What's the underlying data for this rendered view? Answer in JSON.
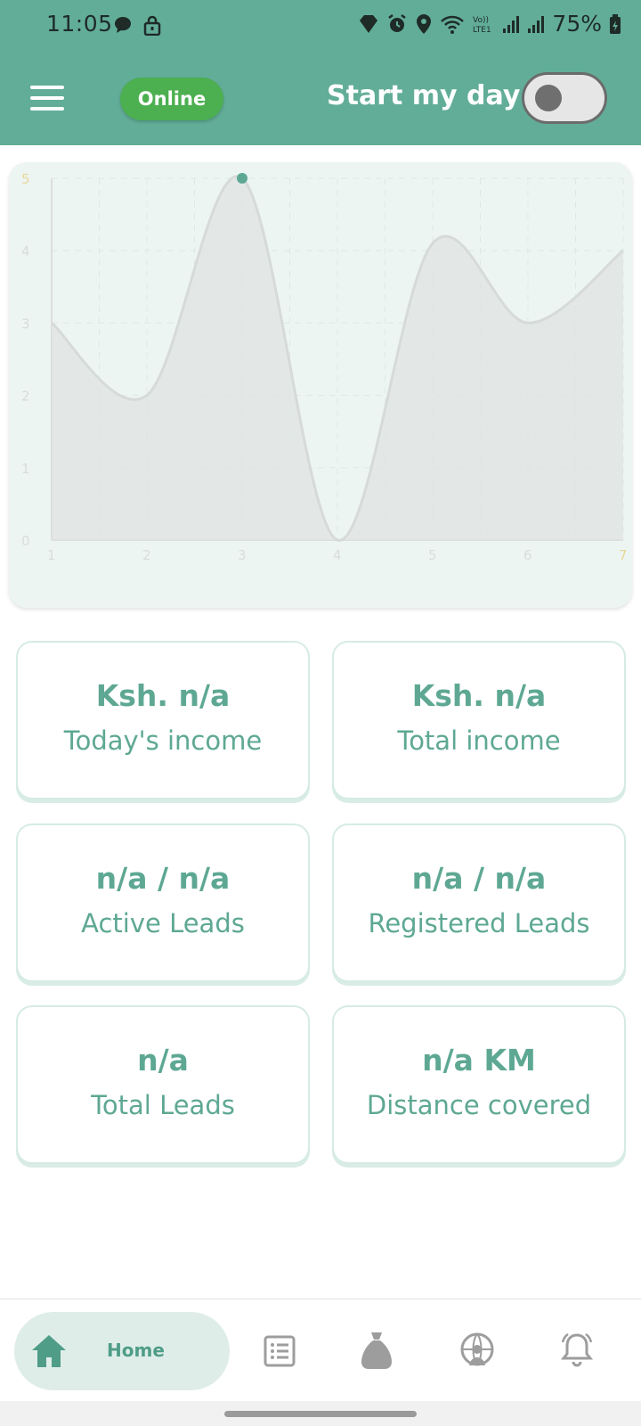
{
  "status_bar": {
    "time": "11:05",
    "battery": "75%",
    "left_icons": [
      "chat-bubble-icon",
      "lock-icon"
    ],
    "right_icons": [
      "diamond-icon",
      "alarm-icon",
      "location-icon",
      "wifi-icon",
      "volte-icon",
      "signal-icon",
      "signal-icon",
      "battery-icon"
    ],
    "volte_label": "Vo)) LTE1"
  },
  "header": {
    "menu_icon": "hamburger-icon",
    "status_pill": "Online",
    "start_day_label": "Start my day",
    "toggle_on": false
  },
  "colors": {
    "header_bg": "#62ad98",
    "online_green": "#4caf50",
    "accent_text": "#5ea893",
    "chart_bg": "#edf5f2"
  },
  "chart_data": {
    "type": "area",
    "x": [
      1,
      2,
      3,
      4,
      5,
      6,
      7
    ],
    "values": [
      3,
      2,
      5,
      0,
      4.1,
      3,
      4
    ],
    "x_tick_labels": [
      "1",
      "2",
      "3",
      "4",
      "5",
      "6",
      "7"
    ],
    "y_tick_labels": [
      "0",
      "1",
      "2",
      "3",
      "4",
      "5"
    ],
    "xlim": [
      1,
      7
    ],
    "ylim": [
      0,
      5
    ],
    "grid": true,
    "smooth": true
  },
  "stats": [
    {
      "value": "Ksh. n/a",
      "label": "Today's income"
    },
    {
      "value": "Ksh. n/a",
      "label": "Total income"
    },
    {
      "value": "n/a / n/a",
      "label": "Active Leads"
    },
    {
      "value": "n/a / n/a",
      "label": "Registered Leads"
    },
    {
      "value": "n/a",
      "label": "Total Leads"
    },
    {
      "value": "n/a KM",
      "label": "Distance covered"
    }
  ],
  "bottom_nav": {
    "home_label": "Home",
    "items": [
      "home-icon",
      "list-icon",
      "money-bag-icon",
      "globe-person-icon",
      "bell-icon"
    ]
  }
}
